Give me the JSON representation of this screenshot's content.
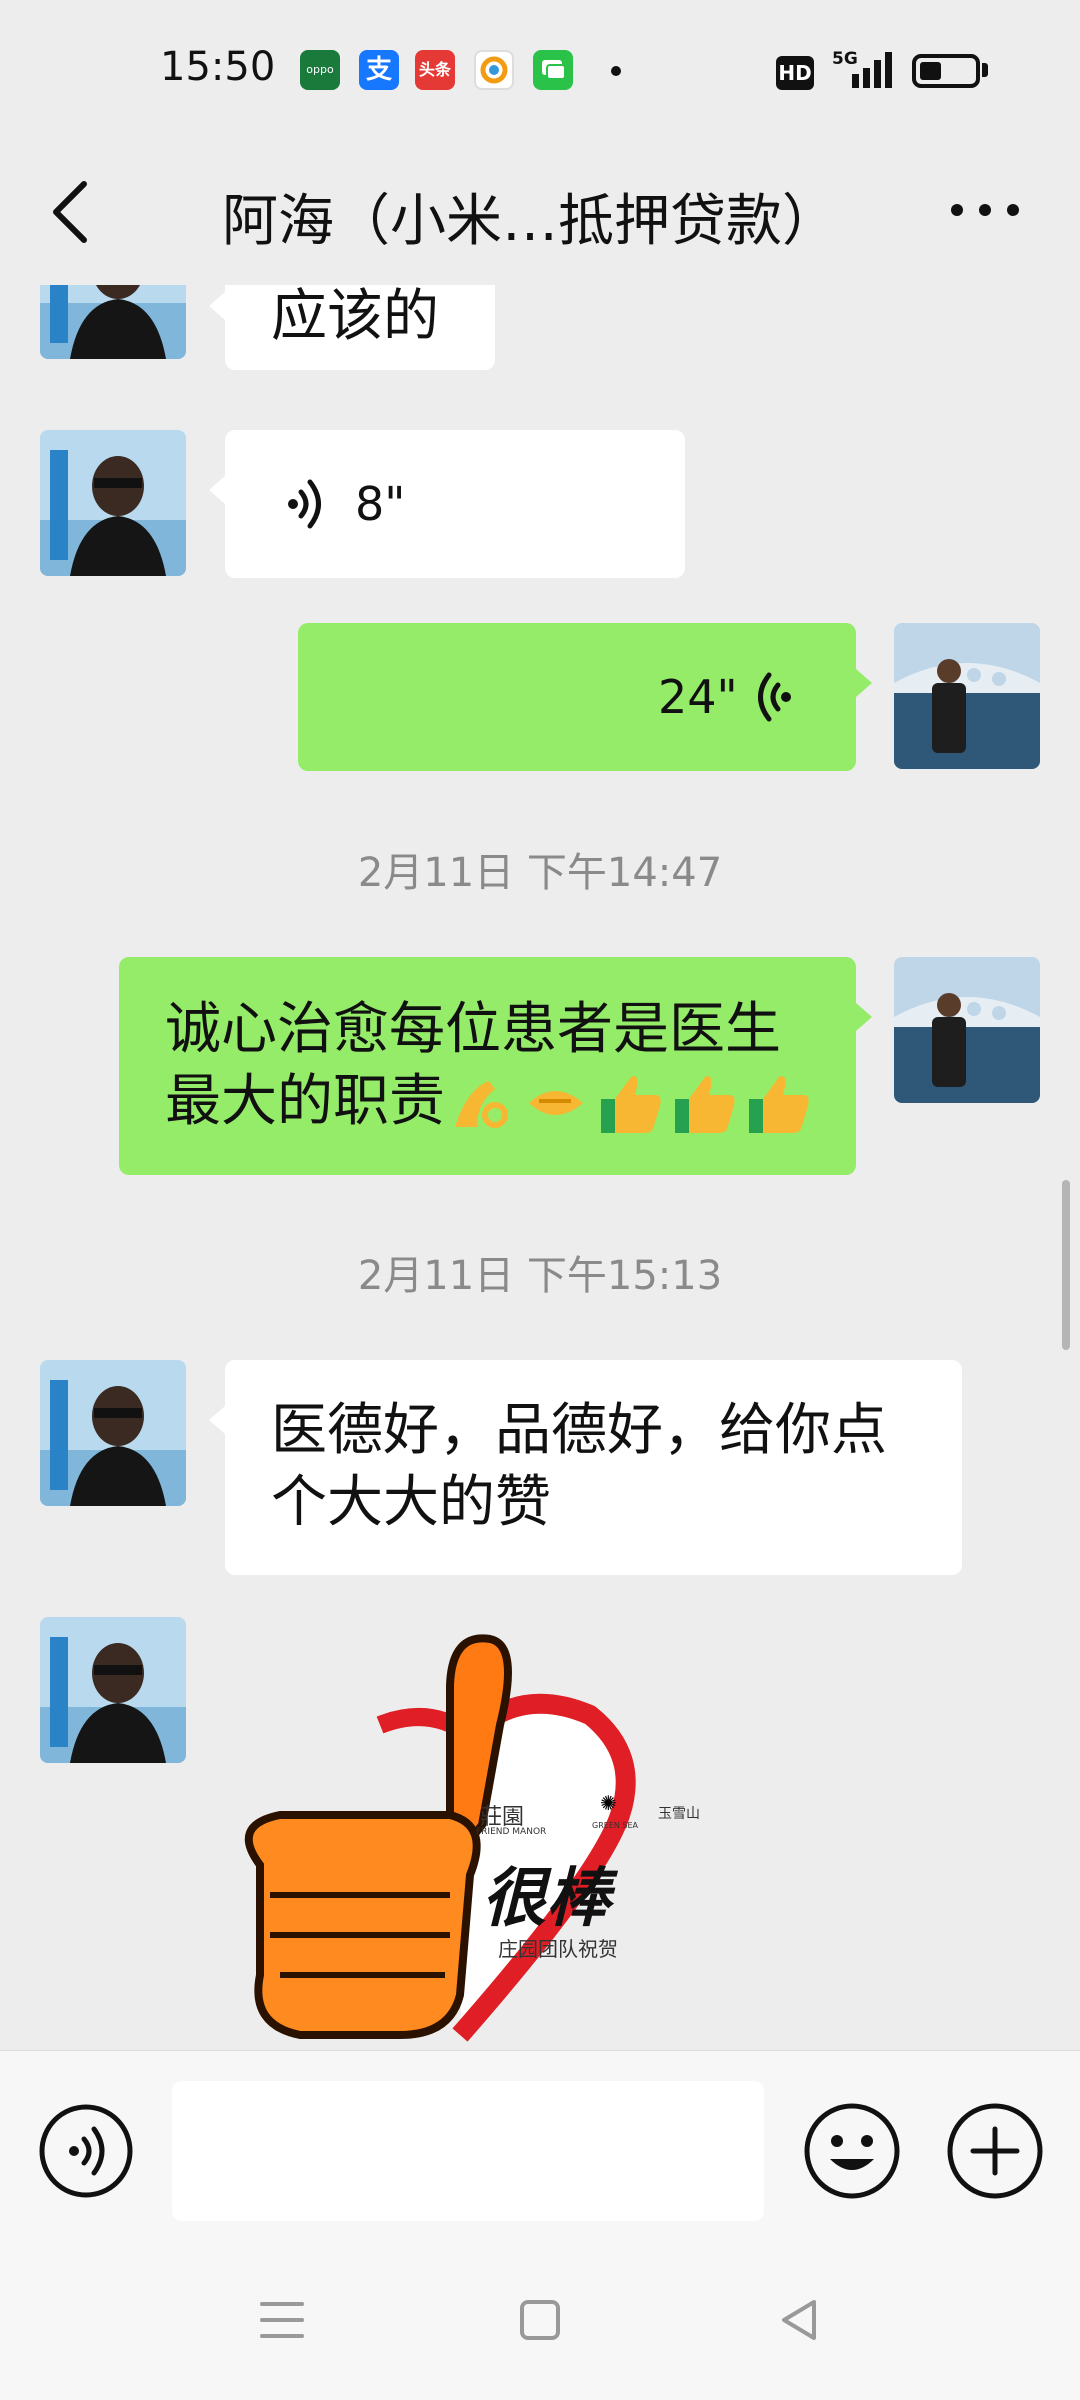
{
  "status_bar": {
    "time": "15:50",
    "apps": [
      {
        "name": "oppo-icon",
        "color": "#1a7a3c",
        "label": "oppo"
      },
      {
        "name": "alipay-icon",
        "color": "#1677ff",
        "label": "支"
      },
      {
        "name": "toutiao-icon",
        "color": "#e53935",
        "label": "头条"
      },
      {
        "name": "ai-app-icon",
        "color": "#ffffff",
        "label": ""
      },
      {
        "name": "chat-app-icon",
        "color": "#2bc24a",
        "label": ""
      }
    ],
    "hd": "HD",
    "network": "5G",
    "battery_level": 0.4
  },
  "header": {
    "title": "阿海（小米…抵押贷款）"
  },
  "messages": [
    {
      "type": "text_in",
      "text": "应该的"
    },
    {
      "type": "voice_in",
      "duration": "8\""
    },
    {
      "type": "voice_out",
      "duration": "24\""
    },
    {
      "type": "timestamp",
      "text": "2月11日 下午14:47"
    },
    {
      "type": "text_out",
      "line1": "诚心治愈每位患者是医生",
      "line2": "最大的职责",
      "emoji": [
        "ok-hand-icon",
        "handshake-icon",
        "thumbs-up-icon",
        "thumbs-up-icon",
        "thumbs-up-icon"
      ]
    },
    {
      "type": "timestamp",
      "text": "2月11日 下午15:13"
    },
    {
      "type": "text_in",
      "line1": "医德好，品德好，给你点",
      "line2": "个大大的赞"
    },
    {
      "type": "sticker_in",
      "main_text": "很棒",
      "brand": "莊園",
      "brand_en": "FRIEND MANOR",
      "caption": "庄园团队祝贺",
      "logo_small": "GREEN SEA",
      "mountain": "玉雪山"
    }
  ],
  "input_bar": {
    "placeholder": ""
  }
}
